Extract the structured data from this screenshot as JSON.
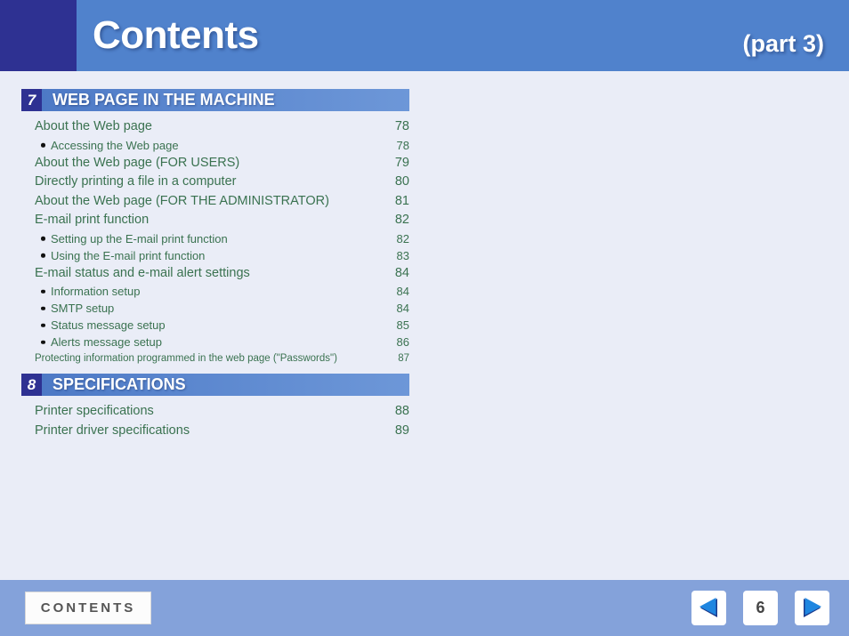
{
  "header": {
    "title": "Contents",
    "part_label": "(part 3)",
    "bg_color": "#5082cc",
    "corner_color": "#2e3192"
  },
  "page_background": "#eaedf7",
  "text_color": "#3a7250",
  "sections": [
    {
      "number": "7",
      "title": "WEB PAGE IN THE MACHINE",
      "entries": [
        {
          "level": 1,
          "label": "About the Web page",
          "page": "78"
        },
        {
          "level": 2,
          "label": "Accessing the Web page",
          "page": "78"
        },
        {
          "level": 1,
          "label": "About the Web page (FOR USERS)",
          "page": "79"
        },
        {
          "level": 1,
          "label": "Directly printing a file in a computer",
          "page": "80"
        },
        {
          "level": 1,
          "label": "About the Web page (FOR THE ADMINISTRATOR)",
          "page": "81"
        },
        {
          "level": 1,
          "label": "E-mail print function",
          "page": "82"
        },
        {
          "level": 2,
          "label": "Setting up the E-mail print function",
          "page": "82"
        },
        {
          "level": 2,
          "label": "Using the E-mail print function",
          "page": "83"
        },
        {
          "level": 1,
          "label": "E-mail status and e-mail alert settings",
          "page": "84"
        },
        {
          "level": 2,
          "label": "Information setup",
          "page": "84"
        },
        {
          "level": 2,
          "label": "SMTP setup",
          "page": "84"
        },
        {
          "level": 2,
          "label": "Status message setup",
          "page": "85"
        },
        {
          "level": 2,
          "label": "Alerts message setup",
          "page": "86"
        },
        {
          "level": "1s",
          "label": "Protecting information programmed in the web page (\"Passwords\")",
          "page": "87"
        }
      ]
    },
    {
      "number": "8",
      "title": "SPECIFICATIONS",
      "entries": [
        {
          "level": 1,
          "label": "Printer specifications",
          "page": "88"
        },
        {
          "level": 1,
          "label": "Printer driver specifications",
          "page": "89"
        }
      ]
    }
  ],
  "footer": {
    "contents_label": "CONTENTS",
    "prev_icon": "triangle-left-icon",
    "next_icon": "triangle-right-icon",
    "page_number": "6",
    "bar_color": "#84a2da"
  }
}
